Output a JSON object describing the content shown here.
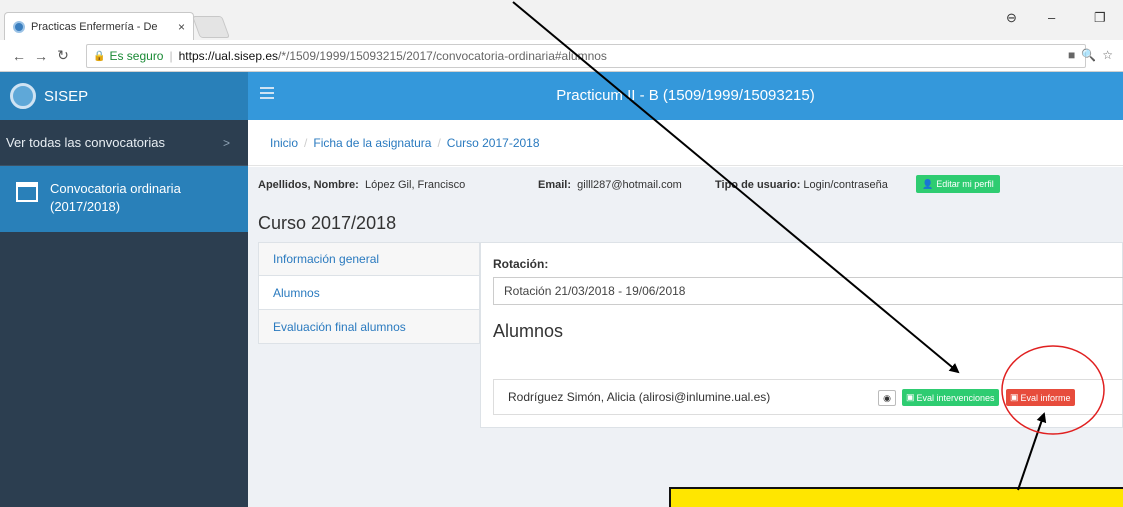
{
  "browser": {
    "tab_title": "Practicas Enfermería - De",
    "tab_close": "×",
    "secure_label": "Es seguro",
    "url_host": "https://ual.sisep.es",
    "url_path": "/*/1509/1999/15093215/2017/convocatoria-ordinaria#alumnos"
  },
  "sidebar": {
    "brand": "SISEP",
    "all_label": "Ver todas las convocatorias",
    "chevron": ">",
    "conv_line1": "Convocatoria ordinaria",
    "conv_line2": "(2017/2018)"
  },
  "header": {
    "title": "Practicum II - B (1509/1999/15093215)"
  },
  "breadcrumb": {
    "items": [
      "Inicio",
      "Ficha de la asignatura",
      "Curso 2017-2018"
    ],
    "separator": "/"
  },
  "user": {
    "name_label": "Apellidos, Nombre:",
    "name_value": "López Gil, Francisco",
    "email_label": "Email:",
    "email_value": "gilll287@hotmail.com",
    "type_label": "Tipo de usuario:",
    "type_value": "Login/contraseña",
    "edit_button": "Editar mi perfil"
  },
  "course": {
    "title": "Curso 2017/2018"
  },
  "menu": {
    "items": [
      "Información general",
      "Alumnos",
      "Evaluación final alumnos"
    ],
    "active": "Alumnos"
  },
  "panel": {
    "rotation_label": "Rotación:",
    "rotation_value": "Rotación 21/03/2018 - 19/06/2018",
    "section_title": "Alumnos",
    "student": "Rodríguez Simón, Alicia  (alirosi@inlumine.ual.es)",
    "eval_interventions": "Eval intervenciones",
    "eval_report": "Eval informe"
  },
  "colors": {
    "sidebar": "#2c3e50",
    "brand": "#2980b9",
    "header": "#3498db",
    "green": "#2ecc71",
    "red": "#e74c3c",
    "callout": "#ffe600"
  }
}
